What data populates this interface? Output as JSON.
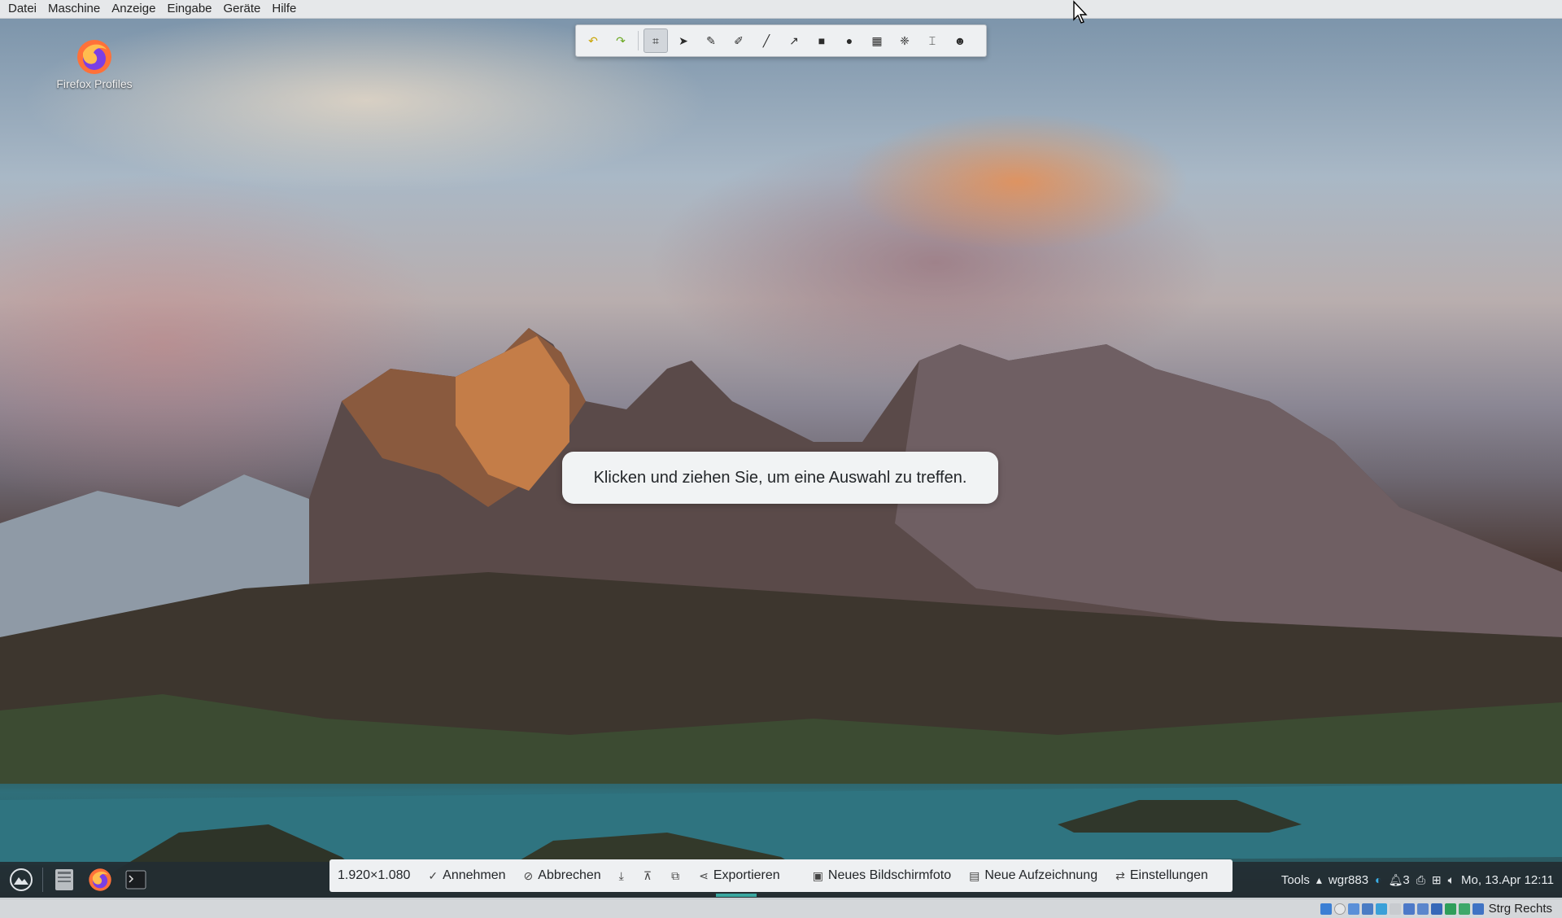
{
  "menubar": {
    "items": [
      "Datei",
      "Maschine",
      "Anzeige",
      "Eingabe",
      "Geräte",
      "Hilfe"
    ]
  },
  "desktop": {
    "icon_label": "Firefox Profiles",
    "hint_text": "Klicken und ziehen Sie, um eine Auswahl zu treffen."
  },
  "screenshot_toolbar": {
    "tools": [
      "undo-icon",
      "redo-icon",
      "crop-icon",
      "select-arrow-icon",
      "highlighter-icon",
      "freehand-pen-icon",
      "line-icon",
      "arrow-icon",
      "rectangle-icon",
      "ellipse-icon",
      "pixelate-icon",
      "blur-icon",
      "text-icon",
      "sticker-icon"
    ],
    "active_tool": "crop-icon"
  },
  "capture_bar": {
    "size_label": "1.920×1.080",
    "accept_label": "Annehmen",
    "cancel_label": "Abbrechen",
    "export_label": "Exportieren",
    "new_screenshot_label": "Neues Bildschirmfoto",
    "new_recording_label": "Neue Aufzeichnung",
    "settings_label": "Einstellungen"
  },
  "tray": {
    "tools_label": "Tools",
    "user_label": "wgr883",
    "notification_count": "3",
    "clock": "Mo, 13.Apr 12:11"
  },
  "statusbar": {
    "host_key_label": "Strg Rechts"
  },
  "colors": {
    "taskbar_bg": "#232c32",
    "accent": "#3aa7a0"
  }
}
